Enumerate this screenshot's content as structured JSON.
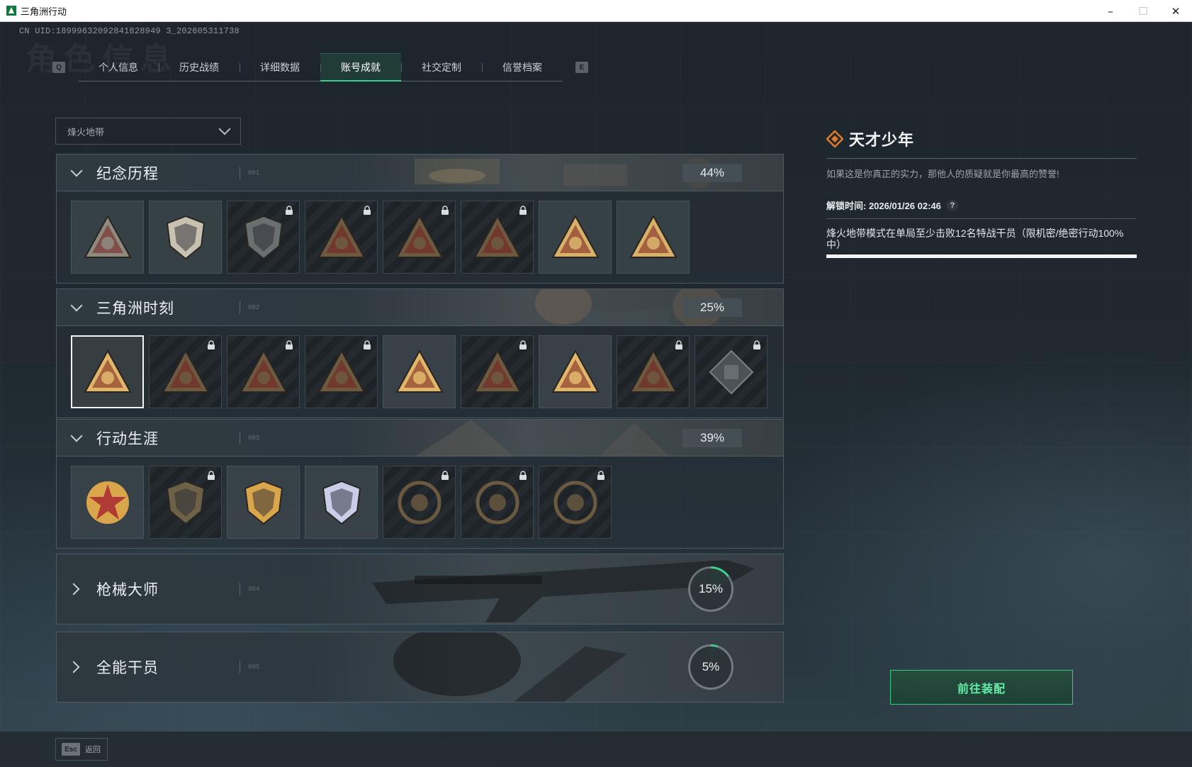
{
  "window": {
    "title": "三角洲行动",
    "controls": {
      "minimize": "–",
      "maximize": "☐",
      "close": "✕"
    }
  },
  "uid": "CN UID:18999632092841828949 3_202605311738",
  "ghost_title": "角色信息",
  "tabs": {
    "left_key": "Q",
    "right_key": "E",
    "items": [
      "个人信息",
      "历史战绩",
      "详细数据",
      "账号成就",
      "社交定制",
      "信誉档案"
    ],
    "active_index": 3
  },
  "mode_select": {
    "value": "烽火地带"
  },
  "sections": [
    {
      "title": "纪念历程",
      "num": "001",
      "progress": "44%",
      "expanded": true,
      "badges": [
        {
          "icon": "triangle-mountain-emblem",
          "locked": false,
          "color": "#8d8a7f"
        },
        {
          "icon": "helicopter-shield-emblem",
          "locked": false,
          "color": "#c9c1b0"
        },
        {
          "icon": "hexagon-shield-emblem",
          "locked": true,
          "color": "#6a6f70"
        },
        {
          "icon": "triangle-vehicle-emblem",
          "locked": true,
          "color": "#6b5a40"
        },
        {
          "icon": "triangle-mask-emblem",
          "locked": true,
          "color": "#6b5a40"
        },
        {
          "icon": "triangle-crossed-emblem",
          "locked": true,
          "color": "#6b5a40"
        },
        {
          "icon": "triangle-dome-emblem",
          "locked": false,
          "color": "#d7b06a"
        },
        {
          "icon": "triangle-number-one-emblem",
          "locked": false,
          "color": "#d7b06a"
        }
      ]
    },
    {
      "title": "三角洲时刻",
      "num": "002",
      "progress": "25%",
      "expanded": true,
      "badges": [
        {
          "icon": "triangle-tower-emblem",
          "locked": false,
          "selected": true,
          "color": "#e0b66a"
        },
        {
          "icon": "triangle-box-emblem",
          "locked": true,
          "color": "#6b5a40"
        },
        {
          "icon": "triangle-soldier-emblem",
          "locked": true,
          "color": "#6b5a40"
        },
        {
          "icon": "triangle-gear-emblem",
          "locked": true,
          "color": "#6b5a40"
        },
        {
          "icon": "triangle-squad-emblem",
          "locked": false,
          "color": "#e0b66a"
        },
        {
          "icon": "triangle-beast-emblem",
          "locked": true,
          "color": "#6b5a40"
        },
        {
          "icon": "triangle-rocket-emblem",
          "locked": false,
          "color": "#e0b66a"
        },
        {
          "icon": "triangle-dragon-emblem",
          "locked": true,
          "color": "#6b5a40"
        },
        {
          "icon": "diamond-cube-emblem",
          "locked": true,
          "color": "#7c8184"
        }
      ]
    },
    {
      "title": "行动生涯",
      "num": "003",
      "progress": "39%",
      "expanded": true,
      "badges": [
        {
          "icon": "star-medal-emblem",
          "locked": false,
          "color": "#d9a64c"
        },
        {
          "icon": "dark-shield-emblem",
          "locked": true,
          "color": "#6d6248"
        },
        {
          "icon": "gold-crest-emblem",
          "locked": false,
          "color": "#d9a64c"
        },
        {
          "icon": "silver-crest-emblem",
          "locked": false,
          "color": "#c9cde8"
        },
        {
          "icon": "ring-emblem",
          "locked": true,
          "color": "#6b5a40"
        },
        {
          "icon": "crosshair-skull-emblem",
          "locked": true,
          "color": "#6b5a40"
        },
        {
          "icon": "eye-ring-emblem",
          "locked": true,
          "color": "#6b5a40"
        }
      ]
    },
    {
      "title": "枪械大师",
      "num": "004",
      "progress": "15%",
      "ring_fraction": 0.15,
      "expanded": false
    },
    {
      "title": "全能干员",
      "num": "005",
      "progress": "5%",
      "ring_fraction": 0.05,
      "expanded": false
    }
  ],
  "detail": {
    "icon": "orange-diamond-icon",
    "title": "天才少年",
    "description": "如果这是你真正的实力，那他人的质疑就是你最高的赞誉!",
    "unlock_label": "解锁时间: 2026/01/26 02:46",
    "help": "?",
    "condition": "烽火地带模式在单局至少击败12名特战干员（限机密/绝密行动100%中）",
    "progress_fraction": 1.0
  },
  "goto_button": "前往装配",
  "footer": {
    "esc_key": "Esc",
    "esc_label": "返回"
  },
  "colors": {
    "accent_green": "#3ad08a",
    "button_text": "#62f0a8",
    "diamond_orange": "#e07a2a",
    "ring_green": "#3ad08a"
  }
}
